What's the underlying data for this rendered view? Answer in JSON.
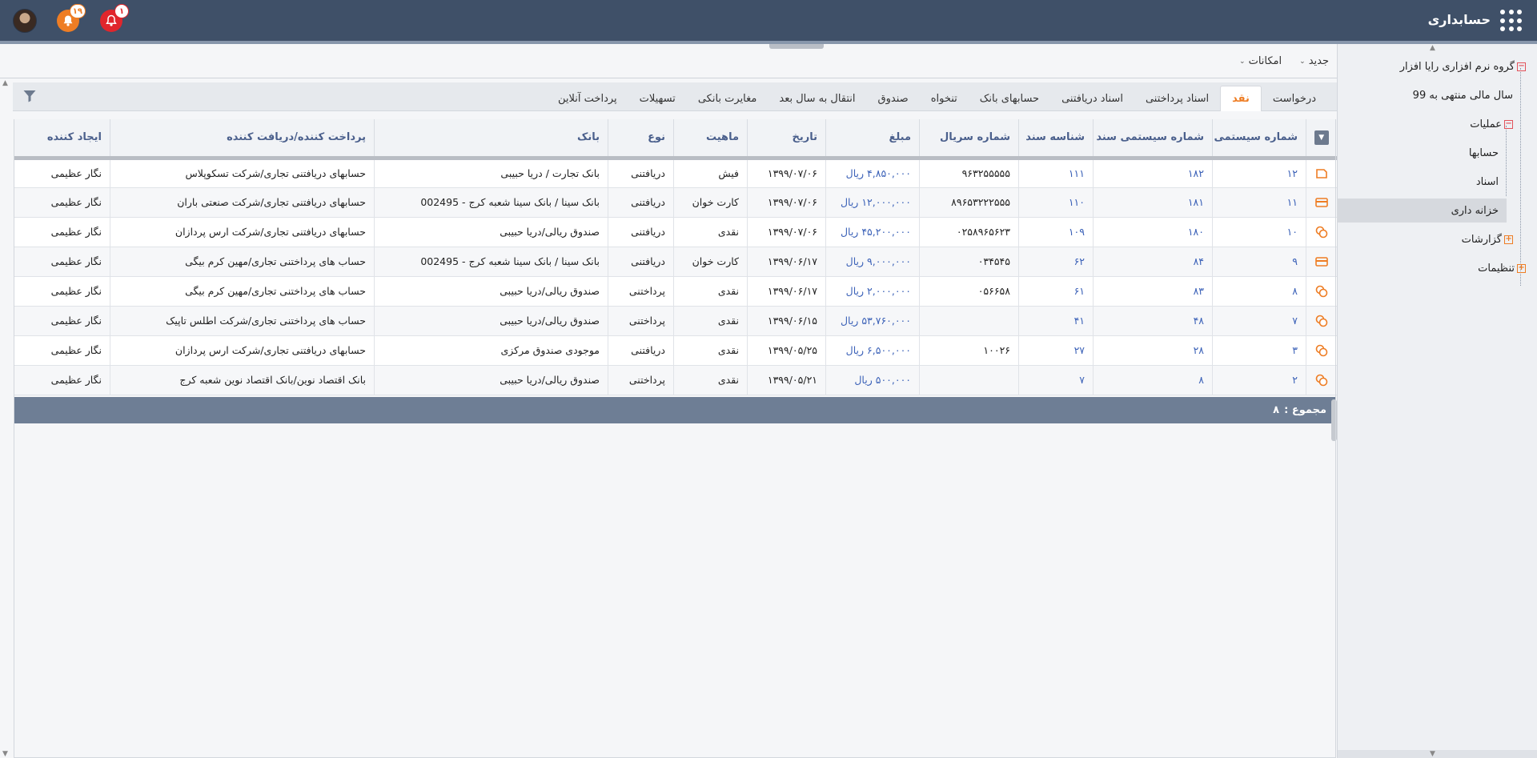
{
  "app": {
    "title": "حسابداری"
  },
  "notifications": {
    "bell_count": "۱۹",
    "alert_count": "۱"
  },
  "toolbar": {
    "new_label": "جدید",
    "features_label": "امکانات"
  },
  "sidebar": {
    "items": [
      {
        "label": "گروه نرم افزاری رایا افزار"
      },
      {
        "label": "سال مالی منتهی به 99"
      },
      {
        "label": "عملیات"
      },
      {
        "label": "حسابها"
      },
      {
        "label": "اسناد"
      },
      {
        "label": "خزانه داری"
      },
      {
        "label": "گزارشات"
      },
      {
        "label": "تنظیمات"
      }
    ]
  },
  "tabs": [
    {
      "label": "درخواست"
    },
    {
      "label": "نقد"
    },
    {
      "label": "اسناد پرداختنی"
    },
    {
      "label": "اسناد دریافتنی"
    },
    {
      "label": "حسابهای بانک"
    },
    {
      "label": "تنخواه"
    },
    {
      "label": "صندوق"
    },
    {
      "label": "انتقال به سال بعد"
    },
    {
      "label": "مغایرت بانکی"
    },
    {
      "label": "تسهیلات"
    },
    {
      "label": "پرداخت آنلاین"
    }
  ],
  "table": {
    "columns": [
      "شماره سیستمی",
      "شماره سیستمی سند",
      "شناسه سند",
      "شماره سریال",
      "مبلغ",
      "تاریخ",
      "ماهیت",
      "نوع",
      "بانک",
      "پرداخت کننده/دریافت کننده",
      "ایجاد کننده"
    ],
    "rows": [
      {
        "icon": "document-icon",
        "sys": "۱۲",
        "doc_sys": "۱۸۲",
        "doc_id": "۱۱۱",
        "serial": "۹۶۳۲۵۵۵۵۵",
        "amount": "۴,۸۵۰,۰۰۰ ریال",
        "date": "۱۳۹۹/۰۷/۰۶",
        "nature": "فیش",
        "type": "دریافتنی",
        "bank": "بانک تجارت / دریا حبیبی",
        "party": "حسابهای دریافتنی تجاری/شرکت تسکوپلاس",
        "creator": "نگار عظیمی"
      },
      {
        "icon": "card-icon",
        "sys": "۱۱",
        "doc_sys": "۱۸۱",
        "doc_id": "۱۱۰",
        "serial": "۸۹۶۵۳۲۲۲۵۵۵",
        "amount": "۱۲,۰۰۰,۰۰۰ ریال",
        "date": "۱۳۹۹/۰۷/۰۶",
        "nature": "کارت خوان",
        "type": "دریافتنی",
        "bank": "بانک سینا / بانک سینا شعبه کرج - 002495",
        "party": "حسابهای دریافتنی تجاری/شرکت صنعتی باران",
        "creator": "نگار عظیمی"
      },
      {
        "icon": "cash-icon",
        "sys": "۱۰",
        "doc_sys": "۱۸۰",
        "doc_id": "۱۰۹",
        "serial": "۰۲۵۸۹۶۵۶۲۳",
        "amount": "۴۵,۲۰۰,۰۰۰ ریال",
        "date": "۱۳۹۹/۰۷/۰۶",
        "nature": "نقدی",
        "type": "دریافتنی",
        "bank": "صندوق ریالی/دریا حبیبی",
        "party": "حسابهای دریافتنی تجاری/شرکت ارس پردازان",
        "creator": "نگار عظیمی"
      },
      {
        "icon": "card-icon",
        "sys": "۹",
        "doc_sys": "۸۴",
        "doc_id": "۶۲",
        "serial": "۰۳۴۵۴۵",
        "amount": "۹,۰۰۰,۰۰۰ ریال",
        "date": "۱۳۹۹/۰۶/۱۷",
        "nature": "کارت خوان",
        "type": "دریافتنی",
        "bank": "بانک سینا / بانک سینا شعبه کرج - 002495",
        "party": "حساب های پرداختنی تجاری/مهین کرم بیگی",
        "creator": "نگار عظیمی"
      },
      {
        "icon": "cash-icon",
        "sys": "۸",
        "doc_sys": "۸۳",
        "doc_id": "۶۱",
        "serial": "۰۵۶۶۵۸",
        "amount": "۲,۰۰۰,۰۰۰ ریال",
        "date": "۱۳۹۹/۰۶/۱۷",
        "nature": "نقدی",
        "type": "پرداختنی",
        "bank": "صندوق ریالی/دریا حبیبی",
        "party": "حساب های پرداختنی تجاری/مهین کرم بیگی",
        "creator": "نگار عظیمی"
      },
      {
        "icon": "cash-icon",
        "sys": "۷",
        "doc_sys": "۴۸",
        "doc_id": "۴۱",
        "serial": "",
        "amount": "۵۳,۷۶۰,۰۰۰ ریال",
        "date": "۱۳۹۹/۰۶/۱۵",
        "nature": "نقدی",
        "type": "پرداختنی",
        "bank": "صندوق ریالی/دریا حبیبی",
        "party": "حساب های پرداختنی تجاری/شرکت اطلس تاپیک",
        "creator": "نگار عظیمی"
      },
      {
        "icon": "cash-icon",
        "sys": "۳",
        "doc_sys": "۲۸",
        "doc_id": "۲۷",
        "serial": "۱۰۰۲۶",
        "amount": "۶,۵۰۰,۰۰۰ ریال",
        "date": "۱۳۹۹/۰۵/۲۵",
        "nature": "نقدی",
        "type": "دریافتنی",
        "bank": "موجودی صندوق مرکزی",
        "party": "حسابهای دریافتنی تجاری/شرکت ارس پردازان",
        "creator": "نگار عظیمی"
      },
      {
        "icon": "cash-icon",
        "sys": "۲",
        "doc_sys": "۸",
        "doc_id": "۷",
        "serial": "",
        "amount": "۵۰۰,۰۰۰ ریال",
        "date": "۱۳۹۹/۰۵/۲۱",
        "nature": "نقدی",
        "type": "پرداختنی",
        "bank": "صندوق ریالی/دریا حبیبی",
        "party": "بانک اقتصاد نوین/بانک اقتصاد نوین شعبه کرج",
        "creator": "نگار عظیمی"
      }
    ],
    "footer": {
      "total_label": "مجموع :",
      "total_value": "۸"
    }
  },
  "colors": {
    "topbar": "#3f5068",
    "accent": "#ee7d24",
    "alert": "#e0262c",
    "link": "#3c62b8",
    "footer": "#6e7e95"
  }
}
